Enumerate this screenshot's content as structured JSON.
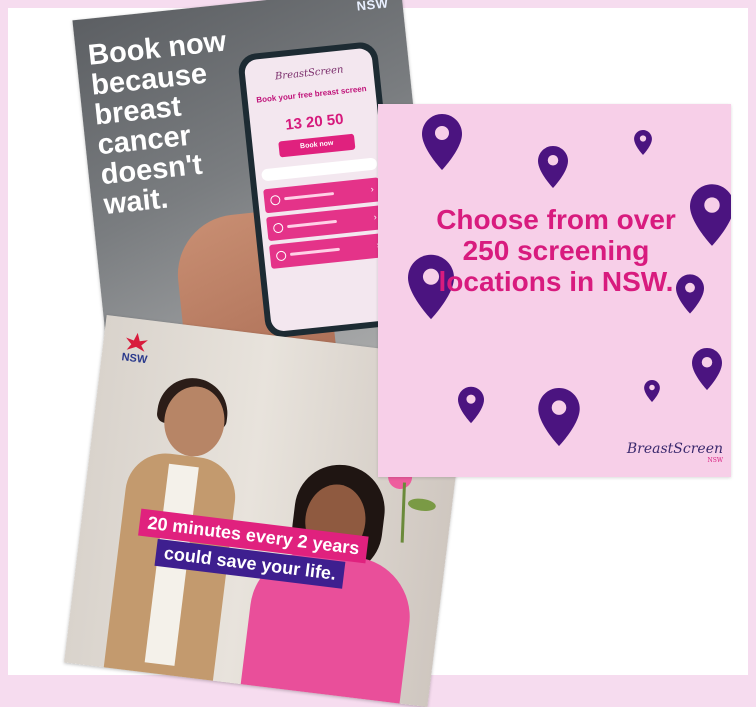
{
  "card_phone": {
    "nsw": "NSW",
    "headline": "Book now because breast cancer doesn't wait.",
    "app_logo": "BreastScreen",
    "book_text": "Book your free breast screen",
    "phone": "13 20 50",
    "book_button": "Book now"
  },
  "card_locations": {
    "text": "Choose from over 250 screening locations in NSW.",
    "brand": "BreastScreen",
    "brand_sub": "NSW",
    "pin_color": "#4b1480"
  },
  "card_photo": {
    "nsw": "NSW",
    "banner_line1": "20 minutes every 2 years",
    "banner_line2": "could save your life."
  },
  "colors": {
    "background": "#f6dcef",
    "pink": "#e0217e",
    "purple": "#3e1f8f",
    "card_pink": "#f7cfe8"
  }
}
